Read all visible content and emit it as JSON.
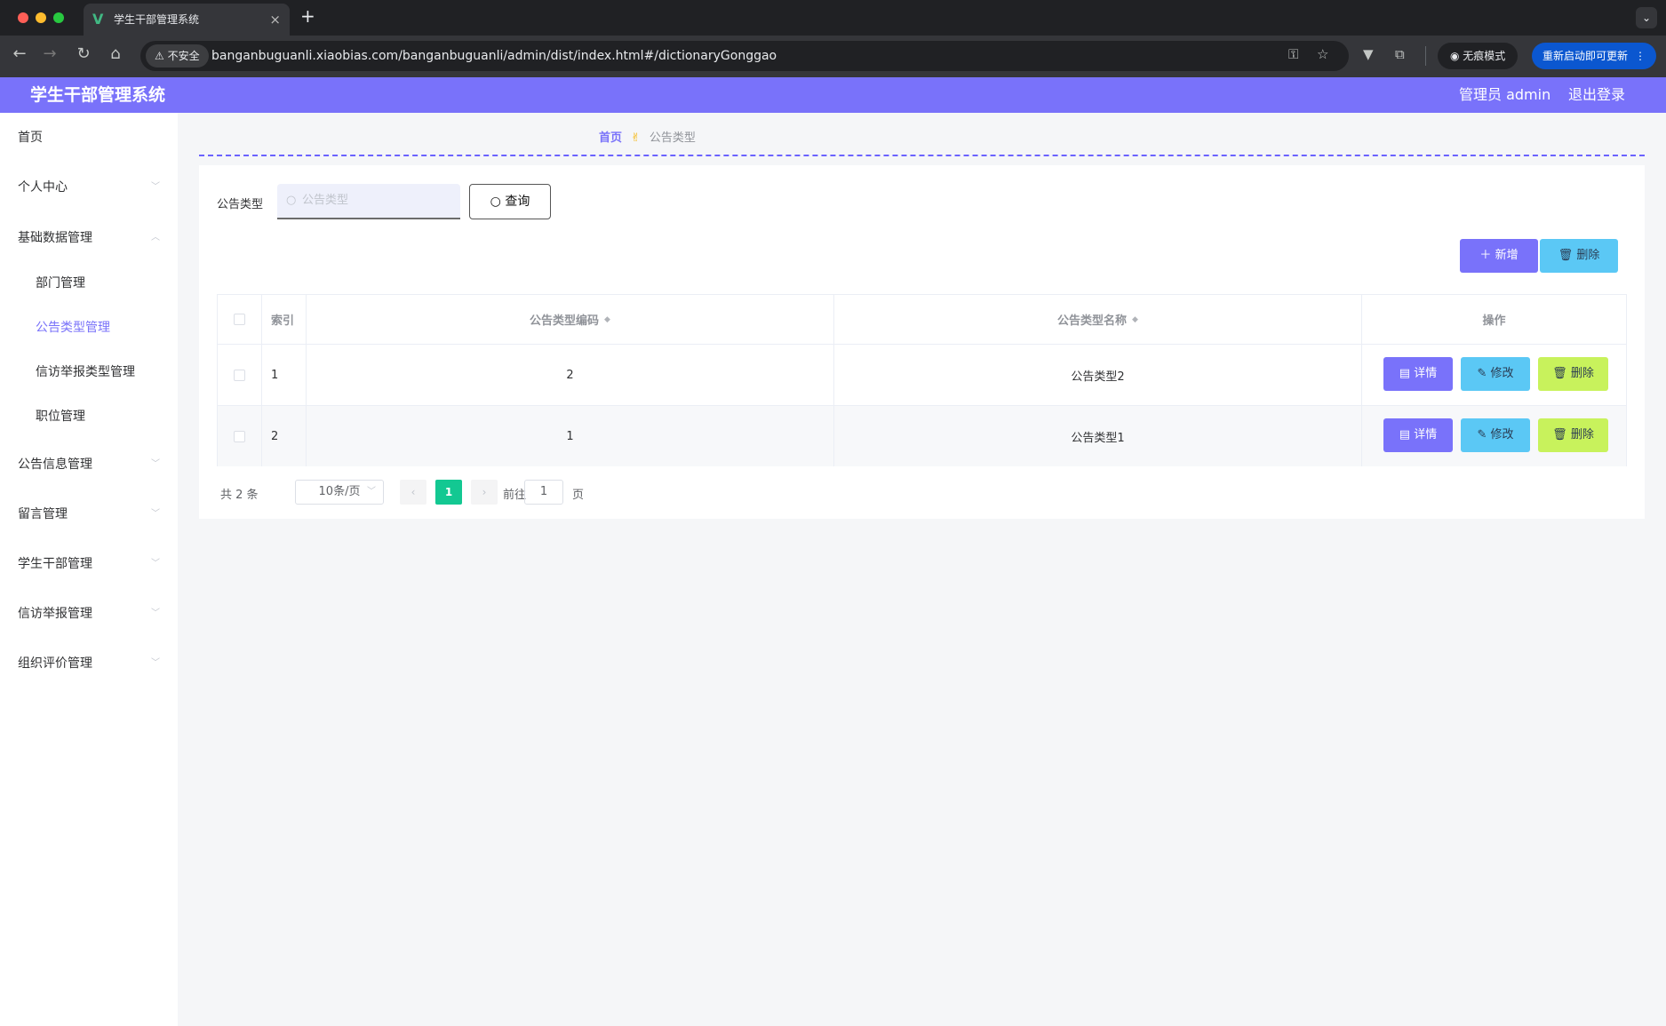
{
  "browser": {
    "tab_title": "学生干部管理系统",
    "tab_close": "×",
    "new_tab": "+",
    "insecure_label": "不安全",
    "url": "banganbuguanli.xiaobias.com/banganbuguanli/admin/dist/index.html#/dictionaryGonggao",
    "incognito_label": "无痕模式",
    "update_label": "重新启动即可更新"
  },
  "header": {
    "title": "学生干部管理系统",
    "user_label": "管理员 admin",
    "logout_label": "退出登录"
  },
  "sidebar": {
    "items": [
      {
        "label": "首页"
      },
      {
        "label": "个人中心"
      },
      {
        "label": "基础数据管理"
      },
      {
        "label": "部门管理"
      },
      {
        "label": "公告类型管理"
      },
      {
        "label": "信访举报类型管理"
      },
      {
        "label": "职位管理"
      },
      {
        "label": "公告信息管理"
      },
      {
        "label": "留言管理"
      },
      {
        "label": "学生干部管理"
      },
      {
        "label": "信访举报管理"
      },
      {
        "label": "组织评价管理"
      }
    ]
  },
  "breadcrumb": {
    "home": "首页",
    "separator": "✌",
    "current": "公告类型"
  },
  "search": {
    "label": "公告类型",
    "placeholder": "公告类型",
    "button_label": "查询"
  },
  "actions": {
    "add_label": "新增",
    "delete_label": "删除"
  },
  "table": {
    "headers": {
      "index": "索引",
      "code": "公告类型编码",
      "name": "公告类型名称",
      "ops": "操作"
    },
    "rows": [
      {
        "index": "1",
        "code": "2",
        "name": "公告类型2"
      },
      {
        "index": "2",
        "code": "1",
        "name": "公告类型1"
      }
    ],
    "row_buttons": {
      "detail": "详情",
      "edit": "修改",
      "delete": "删除"
    }
  },
  "pagination": {
    "total": "共 2 条",
    "page_size": "10条/页",
    "current_page": "1",
    "goto_label": "前往",
    "goto_value": "1",
    "page_unit": "页"
  },
  "colors": {
    "accent": "#7972fa",
    "info": "#5bc8f5",
    "warning": "#c8f25c",
    "success": "#13c892"
  }
}
